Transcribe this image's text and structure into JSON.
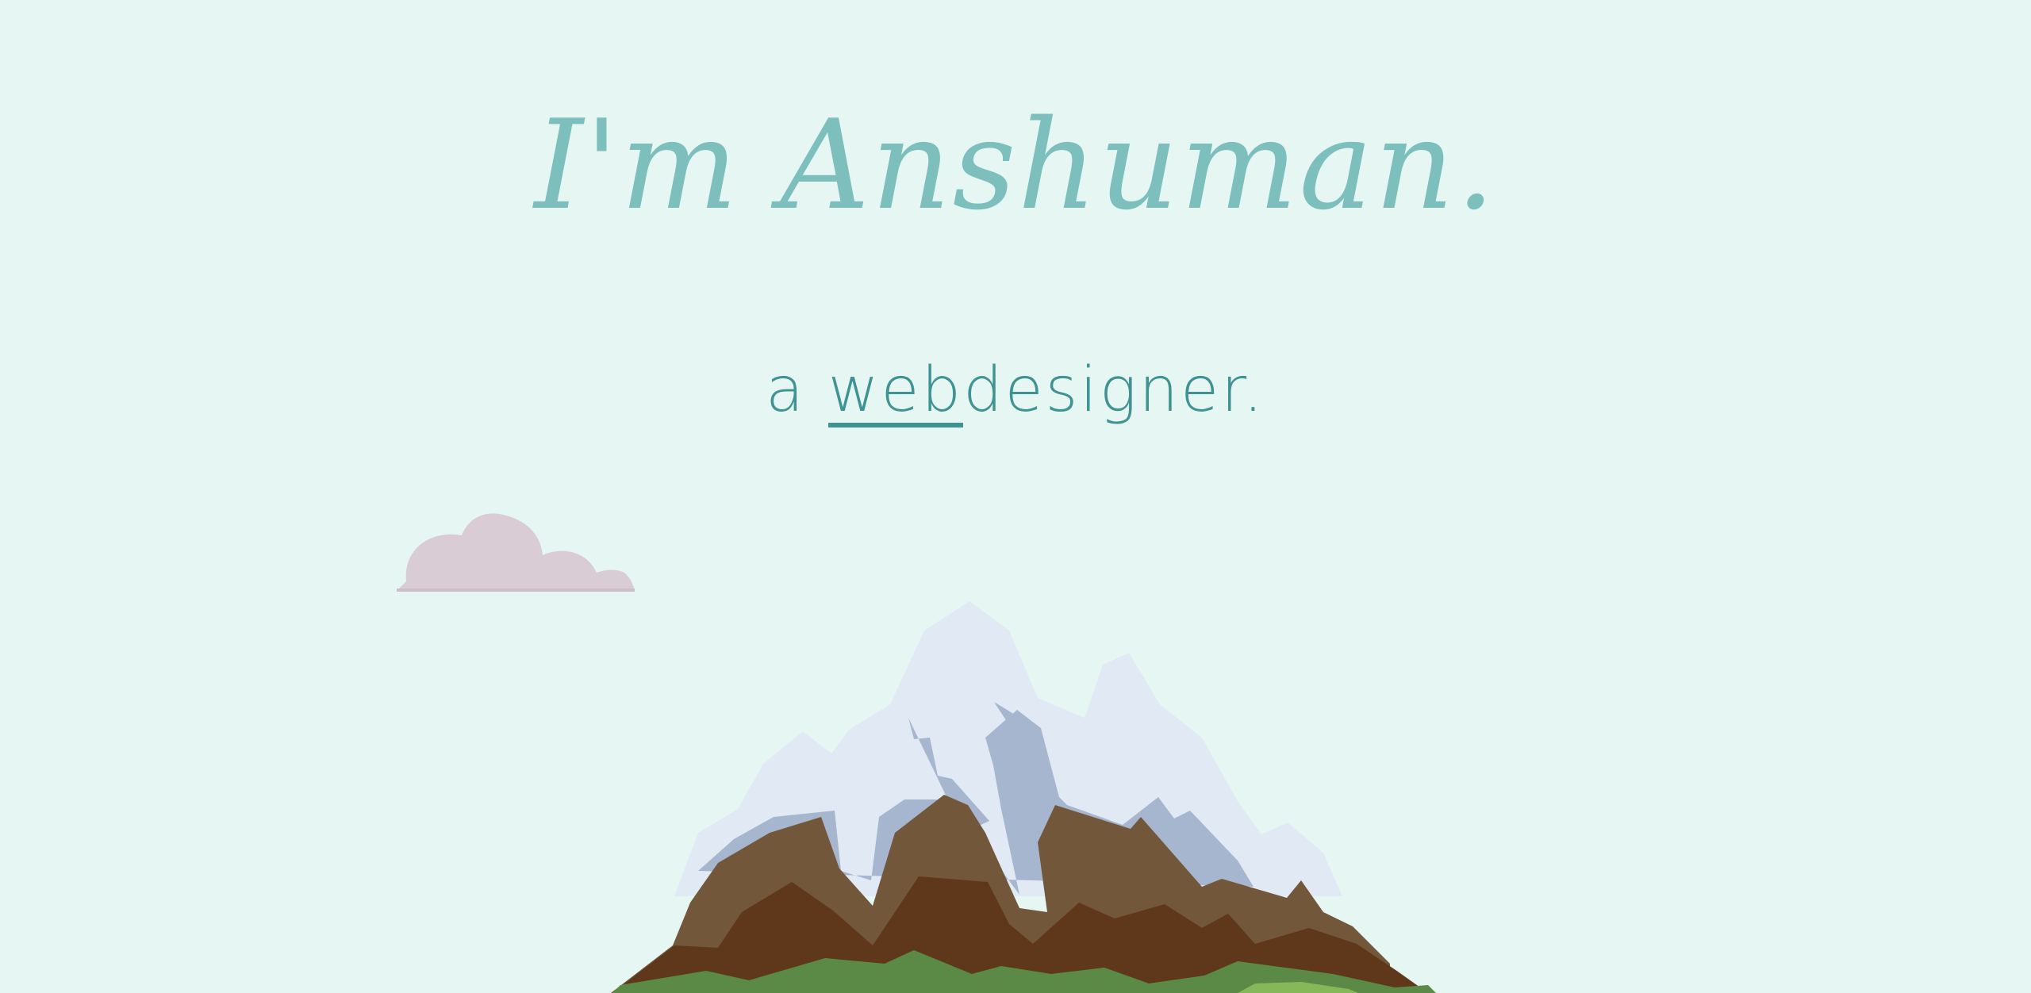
{
  "hero": {
    "title": "I'm Anshuman.",
    "tagline_prefix": "a ",
    "tagline_typed": "web",
    "tagline_rest": "designer."
  },
  "colors": {
    "background": "#e6f7f3",
    "title": "#7dbfbd",
    "tagline": "#3f9393",
    "cloud": "#d9ccd5",
    "snow": "#e1eaf4",
    "snow_shadow": "#a6b6cf",
    "rock_light": "#73573a",
    "rock_dark": "#5f381c",
    "grass": "#5b8a47",
    "grass_light": "#86b85a"
  },
  "icons": {
    "cloud": "cloud-icon",
    "mountain": "mountain-illustration"
  }
}
